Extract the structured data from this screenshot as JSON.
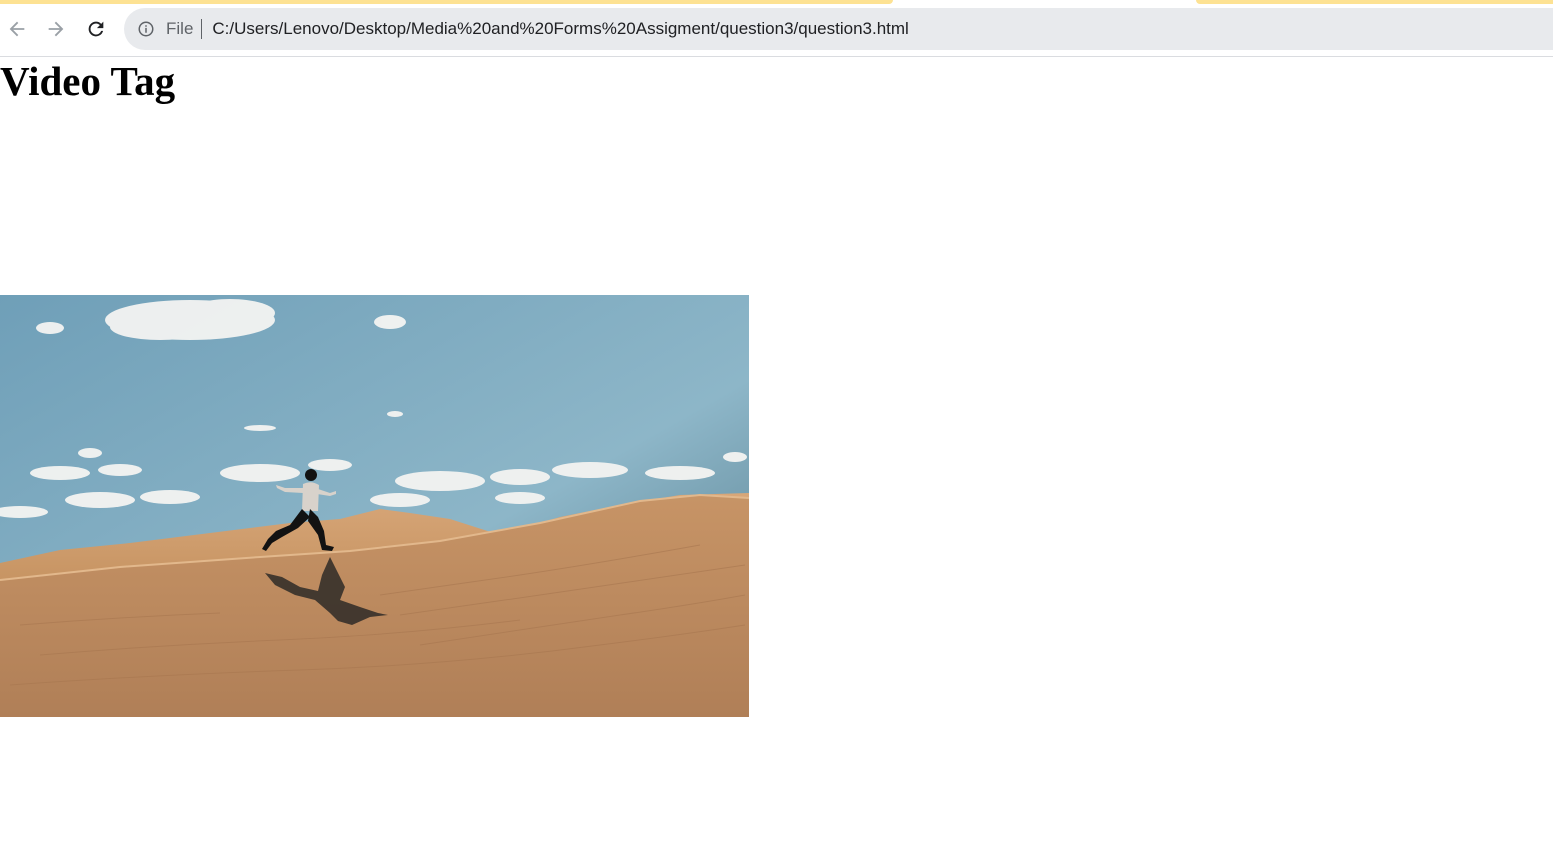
{
  "browser": {
    "back_icon": "arrow-left-icon",
    "forward_icon": "arrow-right-icon",
    "reload_icon": "reload-icon",
    "site_info_icon": "info-circle-icon",
    "scheme_label": "File",
    "url": "C:/Users/Lenovo/Desktop/Media%20and%20Forms%20Assigment/question3/question3.html",
    "accent_color": "#fde293"
  },
  "page": {
    "heading": "Video Tag"
  },
  "video": {
    "content": "person leaping across desert sand dunes under blue sky with clouds"
  }
}
